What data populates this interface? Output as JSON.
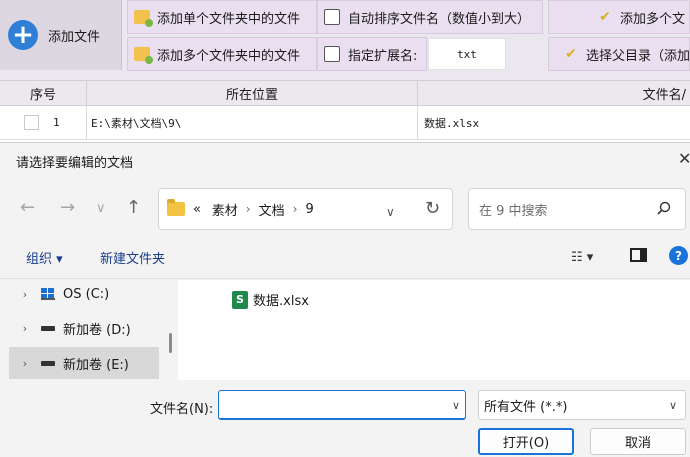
{
  "app": {
    "add_file_label": "添加文件",
    "toolbar": {
      "add_single_folder": "添加单个文件夹中的文件",
      "add_multi_folder": "添加多个文件夹中的文件",
      "auto_sort": "自动排序文件名（数值小到大）",
      "specify_ext": "指定扩展名:",
      "ext_value": "txt",
      "add_multi_right": "添加多个文",
      "select_parent": "选择父目录（添加"
    },
    "table": {
      "headers": [
        "序号",
        "所在位置",
        "文件名/"
      ],
      "rows": [
        {
          "index": "1",
          "location": "E:\\素材\\文档\\9\\",
          "filename": "数据.xlsx"
        }
      ]
    }
  },
  "dialog": {
    "title": "请选择要编辑的文档",
    "close": "✕",
    "nav": {
      "back": "←",
      "forward": "→",
      "recent": "∨",
      "up": "↑"
    },
    "breadcrumb": {
      "prefix": "«",
      "items": [
        "素材",
        "文档",
        "9"
      ]
    },
    "search_placeholder": "在 9 中搜索",
    "commands": {
      "organize": "组织 ▾",
      "new_folder": "新建文件夹",
      "view": "☷ ▾",
      "help": "?"
    },
    "tree": [
      {
        "label": "OS (C:)",
        "icon": "windows-drive-icon"
      },
      {
        "label": "新加卷 (D:)",
        "icon": "drive-icon"
      },
      {
        "label": "新加卷 (E:)",
        "icon": "drive-icon",
        "selected": true
      }
    ],
    "files": [
      {
        "name": "数据.xlsx",
        "icon": "excel-file-icon"
      }
    ],
    "filename_label": "文件名(N):",
    "filename_value": "",
    "filter_value": "所有文件 (*.*)",
    "open_button": "打开(O)",
    "cancel_button": "取消"
  },
  "colors": {
    "accent": "#1a73d9",
    "toolbar_bg": "#e9dff0",
    "dialog_bg": "#f3f3f3"
  }
}
